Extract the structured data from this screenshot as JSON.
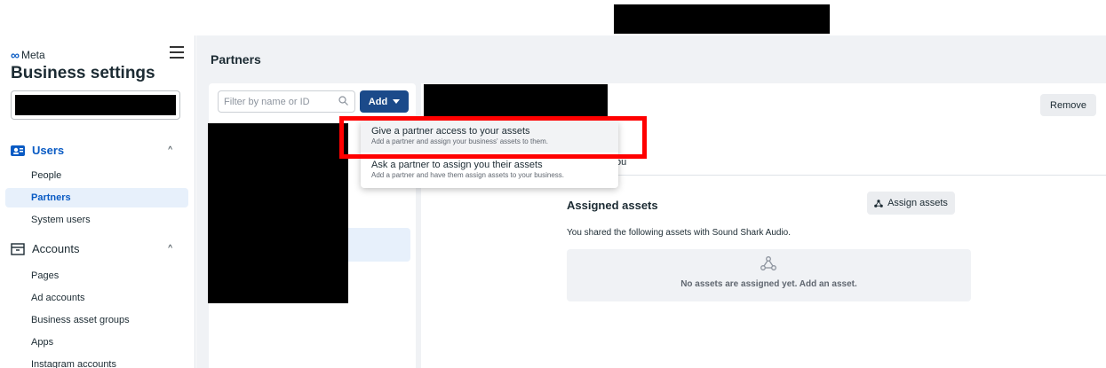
{
  "sidebar": {
    "brand": "Meta",
    "title": "Business settings",
    "users_section": {
      "label": "Users",
      "items": [
        {
          "label": "People"
        },
        {
          "label": "Partners"
        },
        {
          "label": "System users"
        }
      ]
    },
    "accounts_section": {
      "label": "Accounts",
      "items": [
        {
          "label": "Pages"
        },
        {
          "label": "Ad accounts"
        },
        {
          "label": "Business asset groups"
        },
        {
          "label": "Apps"
        },
        {
          "label": "Instagram accounts"
        }
      ]
    }
  },
  "main": {
    "title": "Partners",
    "filter_placeholder": "Filter by name or ID",
    "add_label": "Add",
    "remove_label": "Remove",
    "partner_suffix": "ou",
    "assigned_title": "Assigned assets",
    "assign_label": "Assign assets",
    "shared_text": "You shared the following assets with Sound Shark Audio.",
    "empty_text": "No assets are assigned yet. Add an asset."
  },
  "dropdown": {
    "items": [
      {
        "title": "Give a partner access to your assets",
        "subtitle": "Add a partner and assign your business' assets to them."
      },
      {
        "title": "Ask a partner to assign you their assets",
        "subtitle": "Add a partner and have them assign assets to your business."
      }
    ]
  },
  "colors": {
    "accent": "#0a5bc4",
    "add_button": "#1b4a8a",
    "highlight": "#ff0000"
  }
}
